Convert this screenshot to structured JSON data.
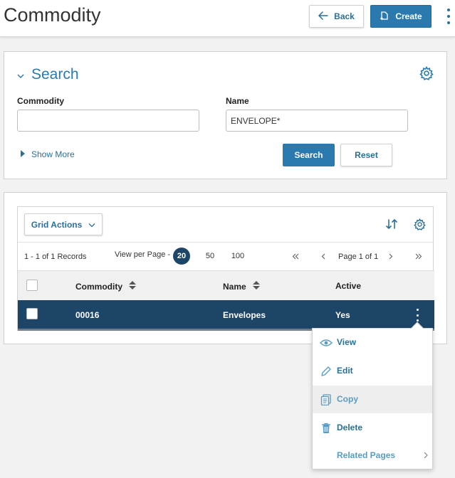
{
  "header": {
    "title": "Commodity",
    "back_label": "Back",
    "create_label": "Create"
  },
  "search": {
    "title": "Search",
    "commodity_label": "Commodity",
    "commodity_value": "",
    "name_label": "Name",
    "name_value": "ENVELOPE*",
    "show_more_label": "Show More",
    "search_button": "Search",
    "reset_button": "Reset"
  },
  "grid": {
    "actions_label": "Grid Actions",
    "records_text": "1 - 1 of 1 Records",
    "view_per_page_label": "View per Page -",
    "page_sizes": [
      "20",
      "50",
      "100"
    ],
    "active_page_size": "20",
    "page_text": "Page 1 of 1",
    "columns": [
      "Commodity",
      "Name",
      "Active"
    ],
    "rows": [
      {
        "commodity": "00016",
        "name": "Envelopes",
        "active": "Yes"
      }
    ]
  },
  "context_menu": {
    "items": [
      "View",
      "Edit",
      "Copy",
      "Delete",
      "Related Pages"
    ]
  },
  "colors": {
    "accent": "#2a7ab0",
    "selected_row": "#1d4568"
  }
}
